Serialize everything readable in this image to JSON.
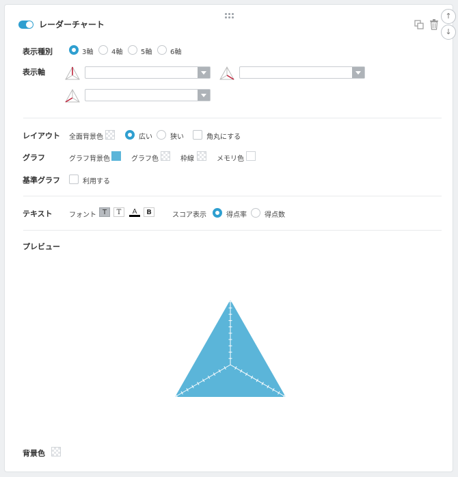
{
  "header": {
    "title": "レーダーチャート",
    "enabled": true
  },
  "display_type": {
    "label": "表示種別",
    "options": [
      "3軸",
      "4軸",
      "5軸",
      "6軸"
    ],
    "selected": "3軸"
  },
  "display_axis": {
    "label": "表示軸",
    "selects": [
      "",
      "",
      ""
    ]
  },
  "layout": {
    "label": "レイアウト",
    "full_bg_label": "全面背景色",
    "wide_label": "広い",
    "narrow_label": "狭い",
    "selected": "広い",
    "rounded_label": "角丸にする"
  },
  "graph": {
    "label": "グラフ",
    "bg_label": "グラフ背景色",
    "bg_color": "#5bb5d9",
    "color_label": "グラフ色",
    "border_label": "枠線",
    "scale_color_label": "メモリ色"
  },
  "base_graph": {
    "label": "基準グラフ",
    "use_label": "利用する"
  },
  "text": {
    "label": "テキスト",
    "font_label": "フォント",
    "font_buttons": [
      "T",
      "T",
      "A",
      "B"
    ],
    "score_label": "スコア表示",
    "score_options": [
      "得点率",
      "得点数"
    ],
    "score_selected": "得点率"
  },
  "preview": {
    "label": "プレビュー",
    "fill_color": "#5bb5d9"
  },
  "background": {
    "label": "背景色"
  },
  "colors": {
    "accent": "#2f9fd0",
    "separator": "#e8eaec"
  },
  "side_buttons": [
    "up-arrow-icon",
    "down-arrow-icon"
  ]
}
